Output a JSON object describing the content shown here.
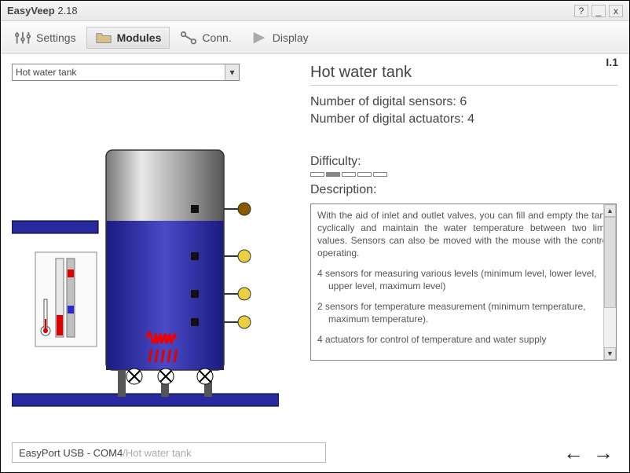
{
  "window": {
    "app_name": "EasyVeep",
    "app_version": "2.18"
  },
  "toolbar": {
    "settings": "Settings",
    "modules": "Modules",
    "conn": "Conn.",
    "display": "Display"
  },
  "version_tag": "I.1",
  "dropdown": {
    "selected": "Hot water tank"
  },
  "module": {
    "title": "Hot water tank",
    "sensors_label": "Number of digital sensors: ",
    "sensors_count": "6",
    "actuators_label": "Number of digital actuators: ",
    "actuators_count": "4",
    "difficulty_label": "Difficulty:",
    "difficulty_level": 2,
    "difficulty_max": 5,
    "description_label": "Description:",
    "description_p1": "With the aid of inlet and outlet valves, you can fill and empty the tank cyclically and maintain the water temperature between two limit values. Sensors can also be moved with the mouse with the control operating.",
    "description_p2": "4 sensors for measuring various levels (minimum level, lower level, upper level, maximum level)",
    "description_p3": "2 sensors for temperature measurement (minimum temperature, maximum temperature).",
    "description_p4": "4 actuators for control of temperature and water supply"
  },
  "status": {
    "port": "EasyPort USB - COM4",
    "sep": "  /  ",
    "module": "Hot water tank"
  }
}
